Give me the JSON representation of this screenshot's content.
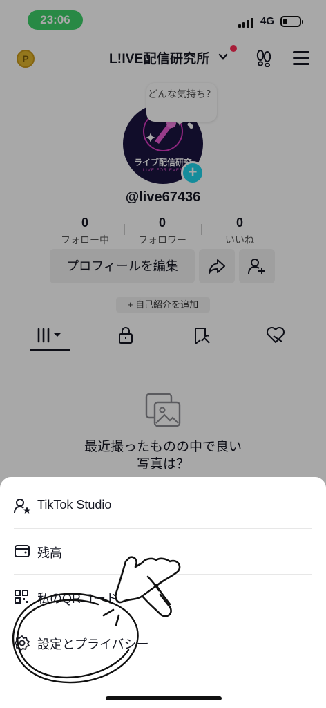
{
  "status_bar": {
    "time": "23:06",
    "network": "4G",
    "battery_level": 0.25,
    "time_pill_color": "#3ed06a"
  },
  "header": {
    "account_name": "L!IVE配信研究所",
    "coin_symbol": "P",
    "icons": [
      "coin-icon",
      "chevron-down-icon",
      "footprint-icon",
      "menu-icon"
    ]
  },
  "profile": {
    "mood_bubble": "どんな気持ち？",
    "avatar_text": "ライブ配信研究",
    "avatar_subtext": "LIVE FOR EVER",
    "username": "@live67436",
    "stats": [
      {
        "count": "0",
        "label": "フォロー中"
      },
      {
        "count": "0",
        "label": "フォロワー"
      },
      {
        "count": "0",
        "label": "いいね"
      }
    ],
    "edit_profile_label": "プロフィールを編集",
    "bio_button_label": "+ 自己紹介を追加"
  },
  "tabs": [
    "videos-grid-icon",
    "private-lock-icon",
    "reposts-icon",
    "liked-heart-icon"
  ],
  "empty_state": {
    "line1": "最近撮ったものの中で良い",
    "line2": "写真は？"
  },
  "sheet": {
    "items": [
      {
        "label": "TikTok Studio",
        "icon": "studio-user-star-icon"
      },
      {
        "label": "残高",
        "icon": "wallet-icon"
      },
      {
        "label": "私のQRコード",
        "icon": "qr-code-icon"
      },
      {
        "label": "設定とプライバシー",
        "icon": "settings-gear-icon"
      }
    ]
  },
  "colors": {
    "accent_red": "#fe2c55",
    "accent_cyan": "#20d5ec",
    "text": "#161823"
  }
}
